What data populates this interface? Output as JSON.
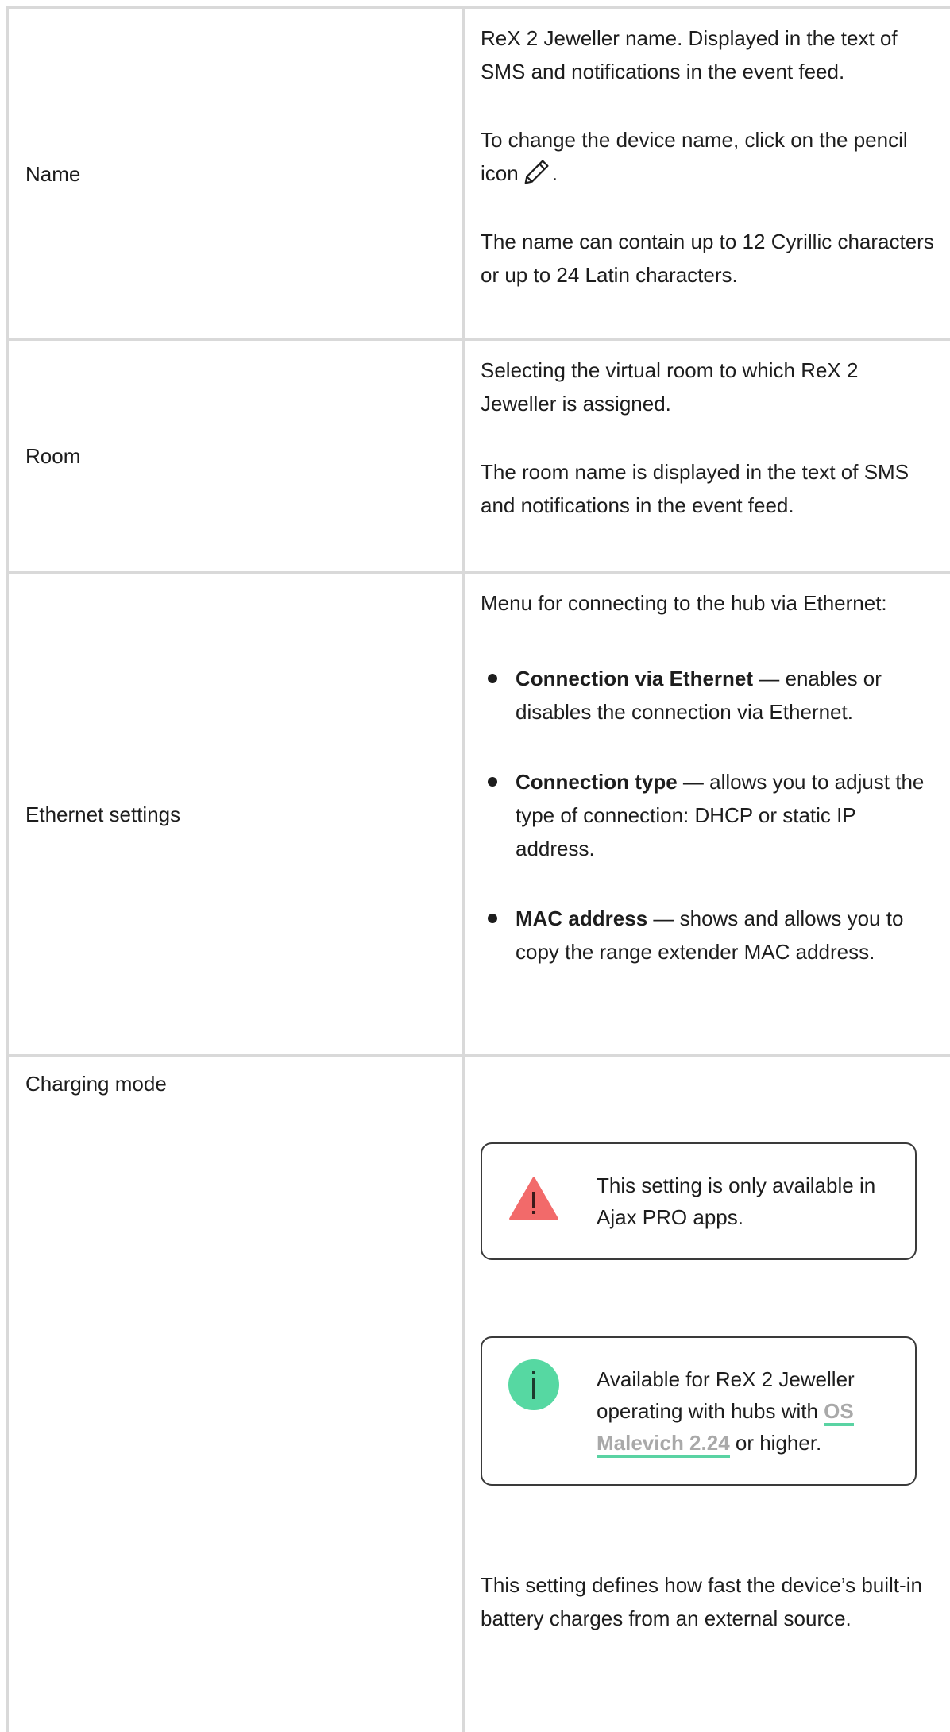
{
  "rows": [
    {
      "label": "Name",
      "paragraphs": [
        "ReX 2 Jeweller name. Displayed in the text of SMS and notifications in the event feed.",
        "To change the device name, click on the pencil icon",
        ".",
        "The name can contain up to 12 Cyrillic characters or up to 24 Latin characters."
      ]
    },
    {
      "label": "Room",
      "paragraphs": [
        "Selecting the virtual room to which ReX 2 Jeweller is assigned.",
        "The room name is displayed in the text of SMS and notifications in the event feed."
      ]
    },
    {
      "label": "Ethernet settings",
      "intro": "Menu for connecting to the hub via Ethernet:",
      "bullets": [
        {
          "term": "Connection via Ethernet",
          "text": " — enables or disables the connection via Ethernet."
        },
        {
          "term": "Connection type",
          "text": " — allows you to adjust the type of connection: DHCP or static IP address."
        },
        {
          "term": "MAC address",
          "text": " — shows and allows you to copy the range extender MAC address."
        }
      ]
    },
    {
      "label": "Charging mode",
      "warning": {
        "icon": "warning-triangle-icon",
        "text": "This setting is only available in Ajax PRO apps.",
        "color": "#f26a6a"
      },
      "info": {
        "icon": "info-circle-icon",
        "text_before": "Available for ReX 2 Jeweller operating with hubs with ",
        "link": "OS Malevich 2.24",
        "text_after": " or higher.",
        "color": "#56d8a2"
      },
      "description": "This setting defines how fast the device’s built-in battery charges from an external source."
    }
  ],
  "colors": {
    "border": "#d9d9d9",
    "text": "#1d1d1d",
    "link_text": "#a9a9a9",
    "link_underline": "#5ad3a3"
  }
}
